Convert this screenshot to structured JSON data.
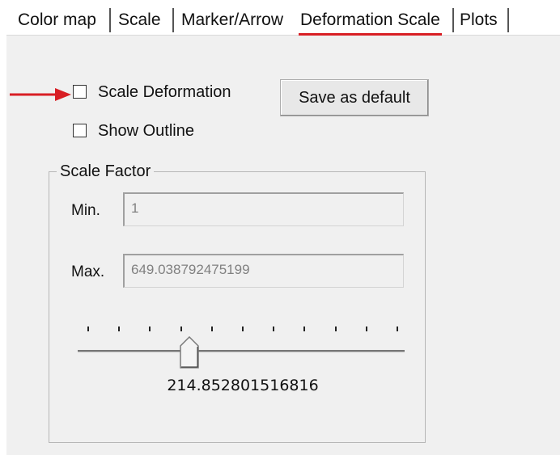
{
  "tabs": [
    {
      "label": "Color map",
      "active": false
    },
    {
      "label": "Scale",
      "active": false
    },
    {
      "label": "Marker/Arrow",
      "active": false
    },
    {
      "label": "Deformation Scale",
      "active": true
    },
    {
      "label": "Plots",
      "active": false
    }
  ],
  "annotation": {
    "arrow_color": "#d81e24",
    "underline_color": "#d81e24"
  },
  "options": {
    "scale_deformation": {
      "label": "Scale Deformation",
      "checked": false
    },
    "show_outline": {
      "label": "Show Outline",
      "checked": false
    }
  },
  "save_default_button": "Save as default",
  "scale_factor": {
    "title": "Scale Factor",
    "min": {
      "label": "Min.",
      "value": "1"
    },
    "max": {
      "label": "Max.",
      "value": "649.038792475199"
    },
    "slider_value": "214.852801516816",
    "slider_position": 0.33,
    "tick_count": 11
  }
}
